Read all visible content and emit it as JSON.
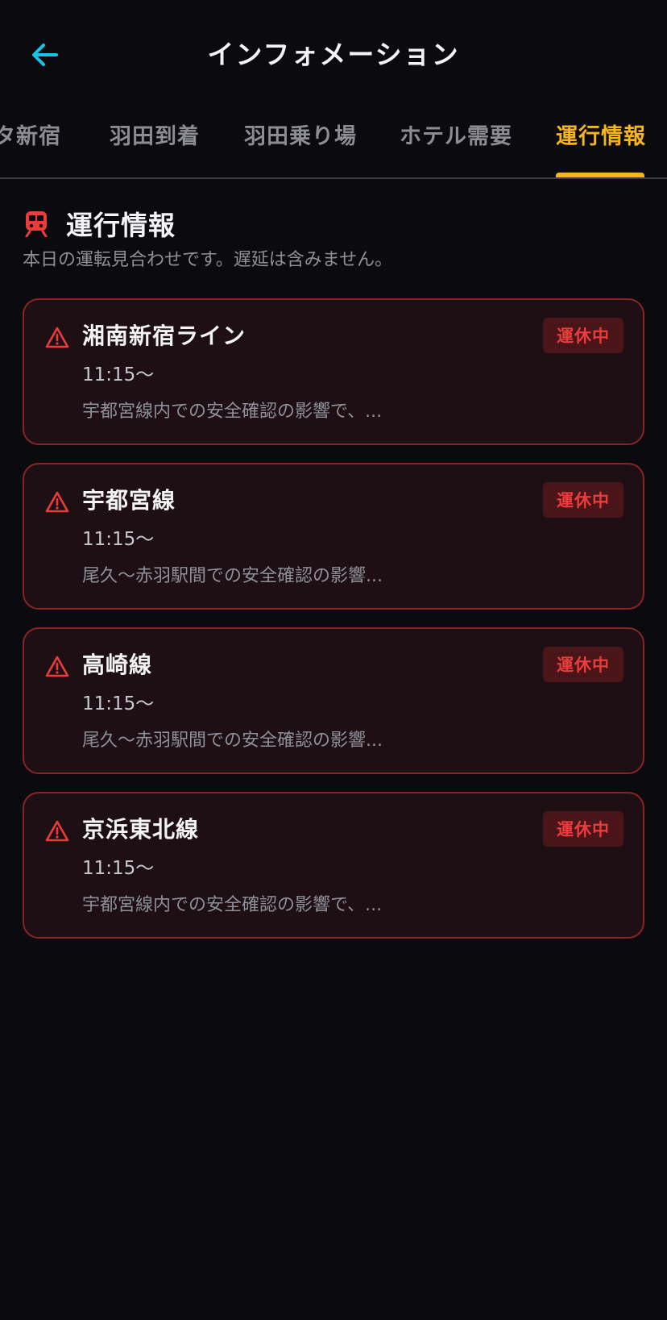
{
  "header": {
    "title": "インフォメーション",
    "back_icon": "arrow-left-icon"
  },
  "tabs": [
    {
      "label": "タ新宿",
      "active": false
    },
    {
      "label": "羽田到着",
      "active": false
    },
    {
      "label": "羽田乗り場",
      "active": false
    },
    {
      "label": "ホテル需要",
      "active": false
    },
    {
      "label": "運行情報",
      "active": true
    }
  ],
  "section": {
    "icon": "train-icon",
    "title": "運行情報",
    "subtitle": "本日の運転見合わせです。遅延は含みません。"
  },
  "alerts": [
    {
      "line": "湘南新宿ライン",
      "status": "運休中",
      "time": "11:15〜",
      "description": "宇都宮線内での安全確認の影響で、..."
    },
    {
      "line": "宇都宮線",
      "status": "運休中",
      "time": "11:15〜",
      "description": "尾久〜赤羽駅間での安全確認の影響..."
    },
    {
      "line": "高崎線",
      "status": "運休中",
      "time": "11:15〜",
      "description": "尾久〜赤羽駅間での安全確認の影響..."
    },
    {
      "line": "京浜東北線",
      "status": "運休中",
      "time": "11:15〜",
      "description": "宇都宮線内での安全確認の影響で、..."
    }
  ],
  "colors": {
    "background": "#0b0b0f",
    "accent": "#f6b51f",
    "back_arrow": "#19c3e6",
    "alert_red": "#ec3b3b",
    "card_border": "#8a2323",
    "card_bg": "#1d0f14",
    "badge_bg": "#4a1518"
  }
}
